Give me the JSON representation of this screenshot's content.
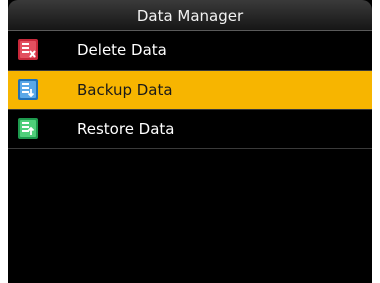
{
  "header": {
    "title": "Data Manager"
  },
  "menu": {
    "items": [
      {
        "label": "Delete Data",
        "icon": "delete-data-icon",
        "selected": false
      },
      {
        "label": "Backup Data",
        "icon": "backup-data-icon",
        "selected": true
      },
      {
        "label": "Restore Data",
        "icon": "restore-data-icon",
        "selected": false
      }
    ]
  },
  "colors": {
    "background": "#000000",
    "highlight": "#f7b500",
    "text": "#ffffff"
  }
}
